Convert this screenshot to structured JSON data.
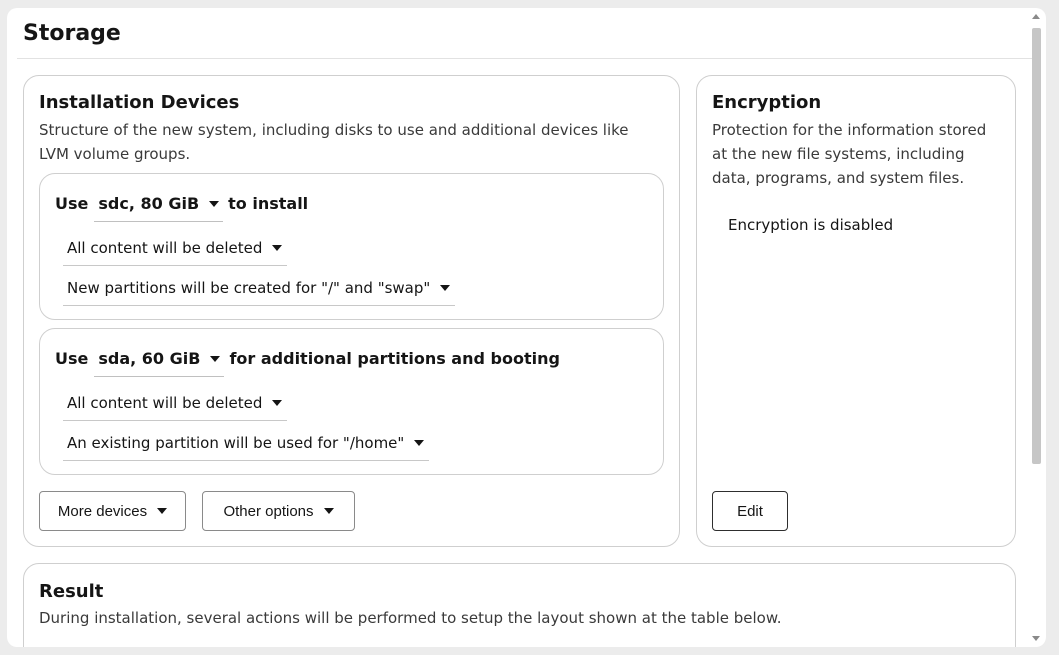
{
  "page": {
    "title": "Storage"
  },
  "installation": {
    "title": "Installation Devices",
    "description": "Structure of the new system, including disks to use and additional devices like LVM volume groups.",
    "devices": [
      {
        "prefix": "Use",
        "device": "sdc, 80 GiB",
        "suffix": "to install",
        "content_option": "All content will be deleted",
        "partition_option": "New partitions will be created for \"/\" and \"swap\""
      },
      {
        "prefix": "Use",
        "device": "sda, 60 GiB",
        "suffix": "for additional partitions and booting",
        "content_option": "All content will be deleted",
        "partition_option": "An existing partition will be used for \"/home\""
      }
    ],
    "more_devices_label": "More devices",
    "other_options_label": "Other options"
  },
  "encryption": {
    "title": "Encryption",
    "description": "Protection for the information stored at the new file systems, including data, programs, and system files.",
    "status": "Encryption is disabled",
    "edit_label": "Edit"
  },
  "result": {
    "title": "Result",
    "description": "During installation, several actions will be performed to setup the layout shown at the table below."
  }
}
